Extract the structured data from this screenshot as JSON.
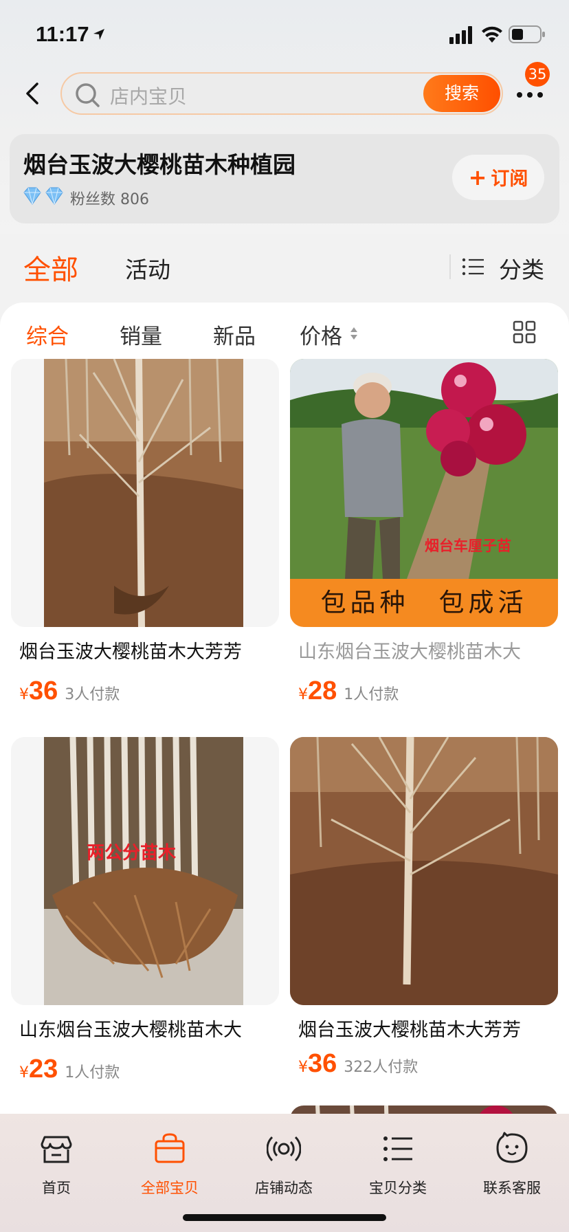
{
  "status": {
    "time": "11:17"
  },
  "search": {
    "placeholder": "店内宝贝",
    "button": "搜索",
    "badge": "35"
  },
  "shop": {
    "name": "烟台玉波大樱桃苗木种植园",
    "fans": "粉丝数 806",
    "subscribe": "订阅"
  },
  "tabs": {
    "all": "全部",
    "activity": "活动",
    "category": "分类"
  },
  "sorts": {
    "overall": "综合",
    "sales": "销量",
    "new": "新品",
    "price": "价格"
  },
  "products": [
    {
      "title": "烟台玉波大樱桃苗木大芳芳",
      "yen": "¥",
      "price": "36",
      "paid": "3人付款"
    },
    {
      "title": "山东烟台玉波大樱桃苗木大",
      "yen": "¥",
      "price": "28",
      "paid": "1人付款",
      "overlay": "烟台车厘子苗",
      "banner": "包品种　包成活"
    },
    {
      "title": "山东烟台玉波大樱桃苗木大",
      "yen": "¥",
      "price": "23",
      "paid": "1人付款",
      "overlay": "两公分苗木"
    },
    {
      "title": "烟台玉波大樱桃苗木大芳芳",
      "yen": "¥",
      "price": "36",
      "paid": "322人付款"
    }
  ],
  "nav": [
    {
      "label": "首页",
      "icon": "shop-icon"
    },
    {
      "label": "全部宝贝",
      "icon": "bag-icon"
    },
    {
      "label": "店铺动态",
      "icon": "broadcast-icon"
    },
    {
      "label": "宝贝分类",
      "icon": "list-icon"
    },
    {
      "label": "联系客服",
      "icon": "service-icon"
    }
  ],
  "colors": {
    "accent": "#ff5000",
    "banner": "#f58a20"
  }
}
